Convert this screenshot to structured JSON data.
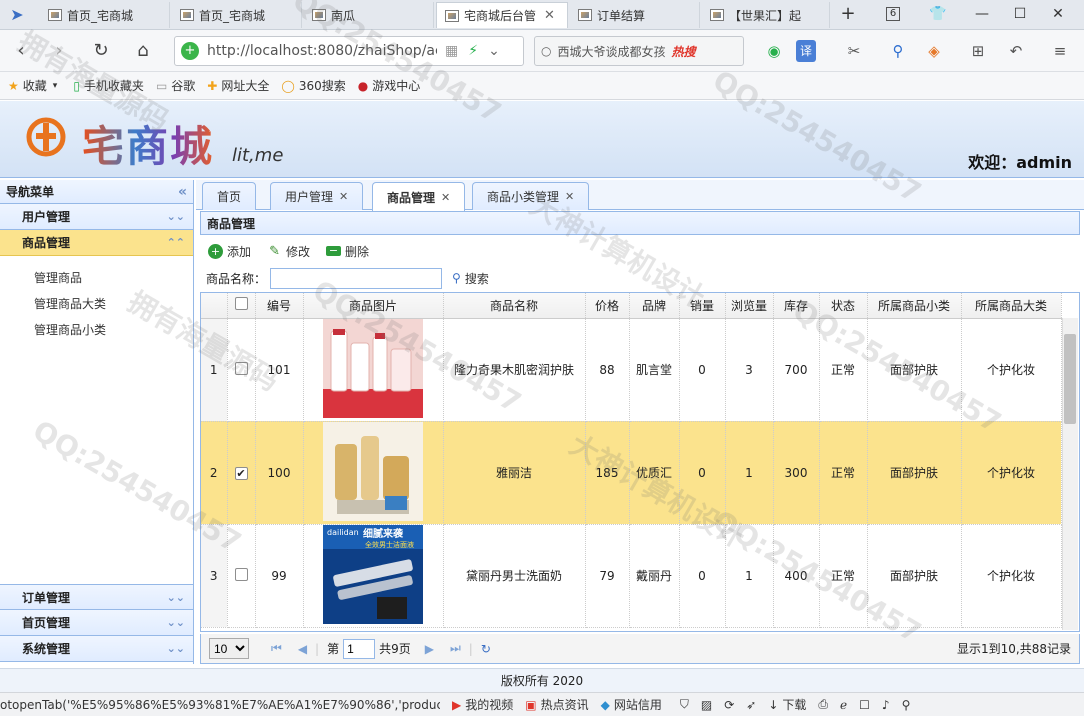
{
  "browser": {
    "tabs": [
      {
        "title": "首页_宅商城",
        "active": false
      },
      {
        "title": "首页_宅商城",
        "active": false
      },
      {
        "title": "南瓜",
        "active": false
      },
      {
        "title": "宅商城后台管",
        "active": true
      },
      {
        "title": "订单结算",
        "active": false
      },
      {
        "title": "【世果汇】起",
        "active": false
      }
    ],
    "tab_count": "6",
    "url": "http://localhost:8080/zhaiShop/ac",
    "search_text": "西城大爷谈成都女孩",
    "search_hot": "热搜",
    "bookmarks": [
      "收藏",
      "手机收藏夹",
      "谷歌",
      "网址大全",
      "360搜索",
      "游戏中心"
    ]
  },
  "app": {
    "logo_text": "宅商城",
    "logo_sub": "lit,me",
    "welcome": "欢迎：admin"
  },
  "leftnav": {
    "title": "导航菜单",
    "sections": [
      {
        "label": "用户管理"
      },
      {
        "label": "商品管理",
        "items": [
          "管理商品",
          "管理商品大类",
          "管理商品小类"
        ]
      },
      {
        "label": "订单管理"
      },
      {
        "label": "首页管理"
      },
      {
        "label": "系统管理"
      }
    ]
  },
  "main": {
    "tabs": [
      "首页",
      "用户管理",
      "商品管理",
      "商品小类管理"
    ],
    "panel_title": "商品管理",
    "toolbar": {
      "add": "添加",
      "edit": "修改",
      "delete": "删除"
    },
    "filter": {
      "label": "商品名称：",
      "search": "搜索"
    },
    "grid": {
      "columns": [
        "编号",
        "商品图片",
        "商品名称",
        "价格",
        "品牌",
        "销量",
        "浏览量",
        "库存",
        "状态",
        "所属商品小类",
        "所属商品大类"
      ],
      "rows": [
        {
          "rn": "1",
          "checked": false,
          "id": "101",
          "name": "隆力奇果木肌密润护肤",
          "price": "88",
          "brand": "肌言堂",
          "sales": "0",
          "views": "3",
          "stock": "700",
          "status": "正常",
          "small": "面部护肤",
          "big": "个护化妆",
          "selected": false
        },
        {
          "rn": "2",
          "checked": true,
          "id": "100",
          "name": "雅丽洁",
          "price": "185",
          "brand": "优质汇",
          "sales": "0",
          "views": "1",
          "stock": "300",
          "status": "正常",
          "small": "面部护肤",
          "big": "个护化妆",
          "selected": true
        },
        {
          "rn": "3",
          "checked": false,
          "id": "99",
          "name": "黛丽丹男士洗面奶",
          "price": "79",
          "brand": "戴丽丹",
          "sales": "0",
          "views": "1",
          "stock": "400",
          "status": "正常",
          "small": "面部护肤",
          "big": "个护化妆",
          "selected": false
        }
      ],
      "img_text": {
        "row3_brand": "dailidan",
        "row3_banner": "细腻来袭",
        "row3_sub": "全效男士洁面液"
      }
    },
    "pager": {
      "page_size": "10",
      "page_prefix": "第",
      "page": "1",
      "total_pages": "共9页",
      "info": "显示1到10,共88记录"
    }
  },
  "footer": "版权所有 2020",
  "status": {
    "script": "otopenTab('%E5%95%86%E5%93%81%E7%AE%A1%E7%90%86','productMar",
    "items": [
      "我的视频",
      "热点资讯",
      "网站信用",
      "下载"
    ]
  },
  "watermarks": [
    "QQ:254540457",
    "拥有海量源码",
    "大神计算机设计"
  ],
  "colors": {
    "accent_blue": "#95b8e7",
    "selected_row": "#fbe38d",
    "header_bg": "#e0ecff"
  }
}
